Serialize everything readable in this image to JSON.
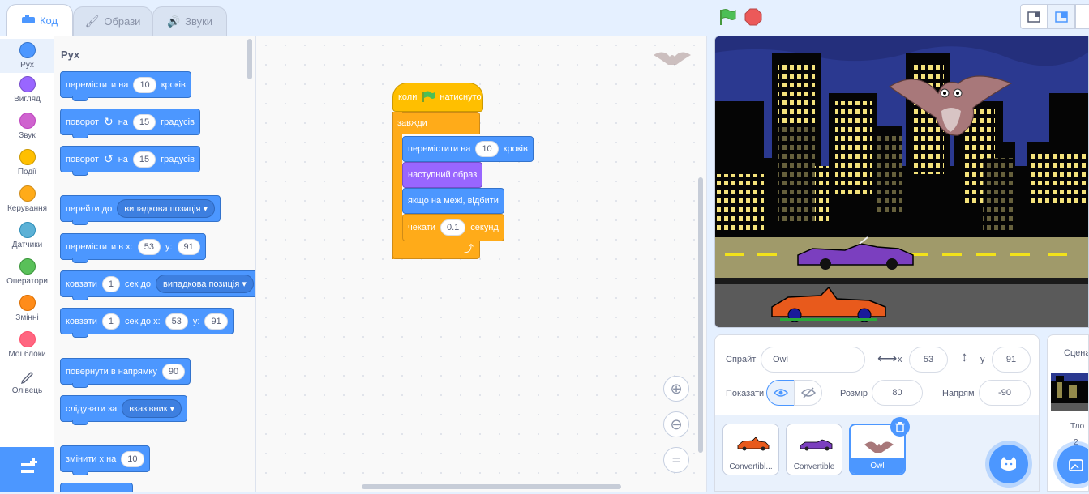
{
  "tabs": {
    "code": "Код",
    "costumes": "Образи",
    "sounds": "Звуки"
  },
  "categories": [
    {
      "label": "Рух",
      "color": "#4c97ff"
    },
    {
      "label": "Вигляд",
      "color": "#9966ff"
    },
    {
      "label": "Звук",
      "color": "#cf63cf"
    },
    {
      "label": "Події",
      "color": "#ffbf00"
    },
    {
      "label": "Керування",
      "color": "#ffab19"
    },
    {
      "label": "Датчики",
      "color": "#5cb1d6"
    },
    {
      "label": "Оператори",
      "color": "#59c059"
    },
    {
      "label": "Змінні",
      "color": "#ff8c1a"
    },
    {
      "label": "Мої блоки",
      "color": "#ff6680"
    },
    {
      "label": "Олівець",
      "color": "#0fbd8c"
    }
  ],
  "palette": {
    "title": "Рух",
    "move": {
      "a": "перемістити на",
      "v": "10",
      "b": "кроків"
    },
    "turn_right": {
      "a": "поворот",
      "b": "на",
      "v": "15",
      "c": "градусів"
    },
    "turn_left": {
      "a": "поворот",
      "b": "на",
      "v": "15",
      "c": "градусів"
    },
    "goto": {
      "a": "перейти до",
      "d": "випадкова позиція"
    },
    "goto_xy": {
      "a": "перемістити в x:",
      "x": "53",
      "b": "y:",
      "y": "91"
    },
    "glide": {
      "a": "ковзати",
      "v": "1",
      "b": "сек до",
      "d": "випадкова позиція"
    },
    "glide_xy": {
      "a": "ковзати",
      "v": "1",
      "b": "сек до x:",
      "x": "53",
      "c": "y:",
      "y": "91"
    },
    "point_dir": {
      "a": "повернути в напрямку",
      "v": "90"
    },
    "point_towards": {
      "a": "слідувати за",
      "d": "вказівник"
    },
    "change_x": {
      "a": "змінити x на",
      "v": "10"
    }
  },
  "script": {
    "hat": {
      "a": "коли",
      "b": "натиснуто"
    },
    "forever": "завжди",
    "move": {
      "a": "перемістити на",
      "v": "10",
      "b": "кроків"
    },
    "next_costume": "наступний образ",
    "bounce": "якщо на межі, відбити",
    "wait": {
      "a": "чекати",
      "v": "0.1",
      "b": "секунд"
    }
  },
  "sprite_info": {
    "sprite_label": "Спрайт",
    "name": "Owl",
    "x_label": "x",
    "x": "53",
    "y_label": "y",
    "y": "91",
    "show_label": "Показати",
    "size_label": "Розмір",
    "size": "80",
    "direction_label": "Напрям",
    "direction": "-90"
  },
  "sprites": [
    {
      "name": "Convertibl...",
      "selected": false
    },
    {
      "name": "Convertible",
      "selected": false
    },
    {
      "name": "Owl",
      "selected": true
    }
  ],
  "scene": {
    "title": "Сцена",
    "backdrops_label": "Тло",
    "backdrops_count": "2"
  }
}
